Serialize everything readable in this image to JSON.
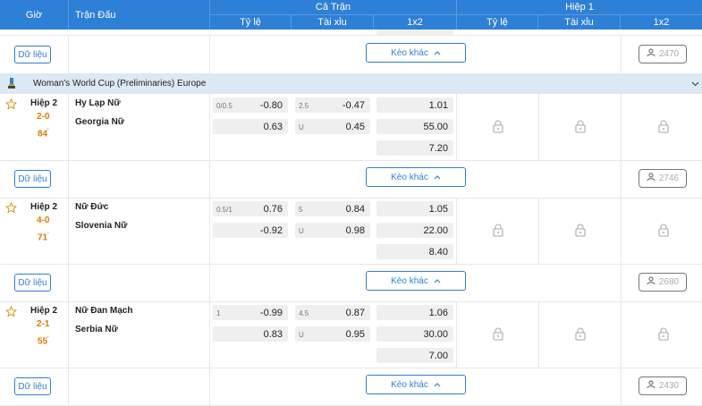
{
  "header": {
    "time": "Giờ",
    "match": "Trận Đấu",
    "full_match": "Cả Trận",
    "first_half": "Hiệp 1",
    "handicap": "Tỷ lệ",
    "over_under": "Tài xỉu",
    "one_x_two": "1x2"
  },
  "labels": {
    "data_button": "Dữ liệu",
    "more_odds": "Kèo khác"
  },
  "top_count": "2470",
  "league": {
    "name": "Woman's World Cup (Preliminaries) Europe"
  },
  "matches": [
    {
      "period": "Hiệp 2",
      "score": "2-0",
      "minute": "84",
      "home": "Hy Lạp Nữ",
      "away": "Georgia Nữ",
      "hdp_line": "0/0.5",
      "hdp_home": "-0.80",
      "hdp_away": "0.63",
      "ou_line": "2.5",
      "ou_under": "U",
      "ou_over": "-0.47",
      "ou_under_val": "0.45",
      "x1": "1.01",
      "x2": "55.00",
      "xdraw": "7.20",
      "count": "2746"
    },
    {
      "period": "Hiệp 2",
      "score": "4-0",
      "minute": "71",
      "home": "Nữ Đức",
      "away": "Slovenia Nữ",
      "hdp_line": "0.5/1",
      "hdp_home": "0.76",
      "hdp_away": "-0.92",
      "ou_line": "5",
      "ou_under": "U",
      "ou_over": "0.84",
      "ou_under_val": "0.98",
      "x1": "1.05",
      "x2": "22.00",
      "xdraw": "8.40",
      "count": "2680"
    },
    {
      "period": "Hiệp 2",
      "score": "2-1",
      "minute": "55",
      "home": "Nữ Đan Mạch",
      "away": "Serbia Nữ",
      "hdp_line": "1",
      "hdp_home": "-0.99",
      "hdp_away": "0.83",
      "ou_line": "4.5",
      "ou_under": "U",
      "ou_over": "0.87",
      "ou_under_val": "0.95",
      "x1": "1.06",
      "x2": "30.00",
      "xdraw": "7.00",
      "count": "2430"
    }
  ]
}
